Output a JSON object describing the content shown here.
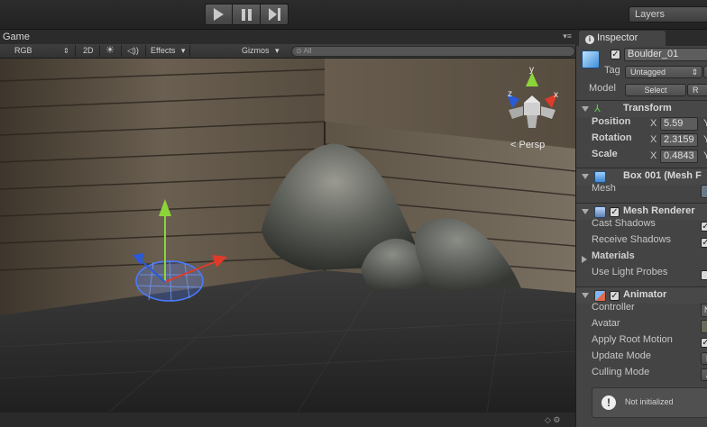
{
  "toolbar": {
    "play_icon": "play-icon",
    "pause_icon": "pause-icon",
    "step_icon": "step-icon",
    "layers_label": "Layers"
  },
  "game": {
    "tab_label": "Game",
    "display_mode": "RGB",
    "twod_label": "2D",
    "effects_label": "Effects",
    "gizmos_label": "Gizmos",
    "search_placeholder": "All",
    "view_gizmo_label": "< Persp",
    "axis_labels": {
      "x": "x",
      "y": "y",
      "z": "z"
    }
  },
  "inspector": {
    "tab_label": "Inspector",
    "object_name": "Boulder_01",
    "active": true,
    "tag_label": "Tag",
    "tag_value": "Untagged",
    "model_label": "Model",
    "select_button": "Select",
    "transform": {
      "title": "Transform",
      "position_label": "Position",
      "rotation_label": "Rotation",
      "scale_label": "Scale",
      "axis_x": "X",
      "axis_y": "Y",
      "position_x": "5.59",
      "rotation_x": "2.3159",
      "scale_x": "0.4843"
    },
    "mesh_filter": {
      "title": "Box 001 (Mesh F",
      "mesh_label": "Mesh"
    },
    "mesh_renderer": {
      "title": "Mesh Renderer",
      "enabled": true,
      "cast_shadows_label": "Cast Shadows",
      "receive_shadows_label": "Receive Shadows",
      "materials_label": "Materials",
      "use_light_probes_label": "Use Light Probes"
    },
    "animator": {
      "title": "Animator",
      "enabled": true,
      "controller_label": "Controller",
      "avatar_label": "Avatar",
      "apply_root_motion_label": "Apply Root Motion",
      "update_mode_label": "Update Mode",
      "culling_mode_label": "Culling Mode",
      "controller_value": "N",
      "update_mode_value": "N",
      "culling_mode_value": "A"
    },
    "warning_text": "Not initialized"
  },
  "colors": {
    "toolbar_bg": "#252525",
    "panel_bg": "#444444",
    "gizmo_y": "#8bd53a",
    "gizmo_x": "#e03a2a",
    "gizmo_z": "#2a5ad8",
    "selection_wire": "#4a7bff"
  }
}
